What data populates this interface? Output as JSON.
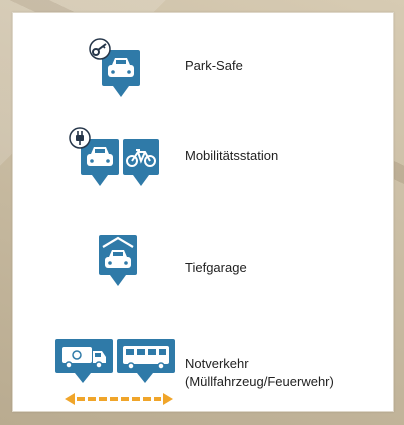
{
  "legend": {
    "items": [
      {
        "label": "Park-Safe"
      },
      {
        "label": "Mobilitätsstation"
      },
      {
        "label": "Tiefgarage"
      },
      {
        "label": "Notverkehr\n(Müllfahrzeug/Feuerwehr)"
      }
    ]
  },
  "colors": {
    "marker_blue": "#2f7aa8",
    "arrow_orange": "#f0a52a",
    "badge_bg": "#ffffff",
    "badge_dark": "#26364a"
  },
  "icons": [
    "key-badge-icon",
    "car-icon",
    "plug-badge-icon",
    "bicycle-icon",
    "garage-roof-icon",
    "garbage-truck-icon",
    "fire-truck-icon",
    "double-arrow-icon"
  ]
}
